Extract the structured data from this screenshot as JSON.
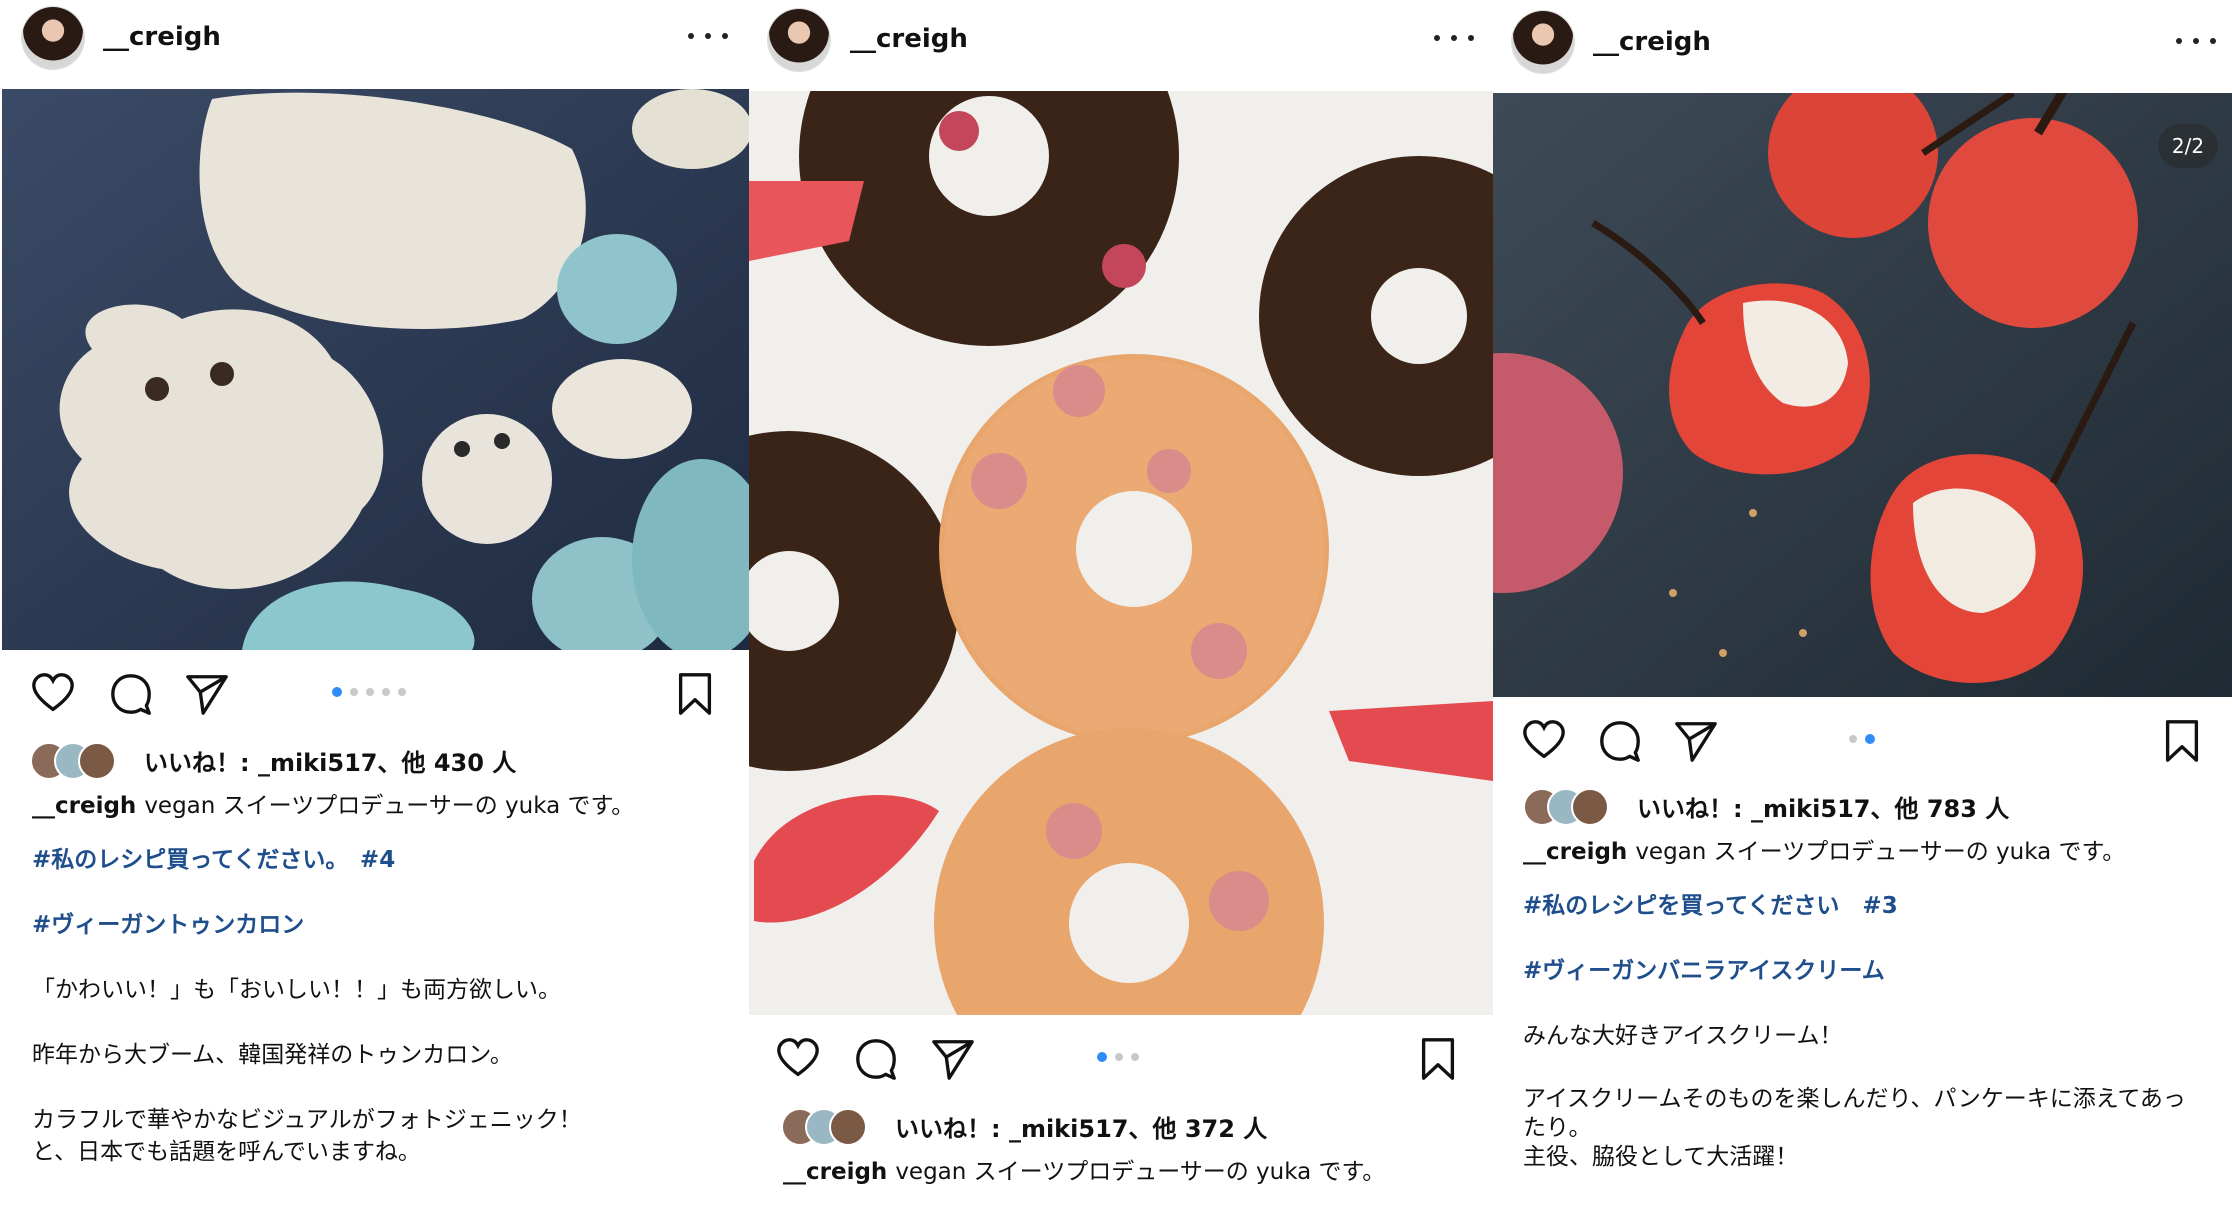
{
  "posts": [
    {
      "username": "__creigh",
      "likes_text": "いいね！: _miki517、他 430 人",
      "caption_user": "__creigh",
      "caption_intro": "vegan スイーツプロデューサーの yuka です。",
      "hashtag_line_1": "#私のレシピ買ってください。　#4",
      "hashtag_line_2": "#ヴィーガントゥンカロン",
      "body_1": "「かわいい！」も「おいしい！！」も両方欲しい。",
      "body_2": "昨年から大ブーム、韓国発祥のトゥンカロン。",
      "body_3": "カラフルで華やかなビジュアルがフォトジェニック！\nと、日本でも話題を呼んでいますね。",
      "carousel": {
        "count": 5,
        "active": 0
      }
    },
    {
      "username": "__creigh",
      "likes_text": "いいね！: _miki517、他 372 人",
      "caption_user": "__creigh",
      "caption_intro": "vegan スイーツプロデューサーの yuka です。",
      "carousel": {
        "count": 3,
        "active": 0
      }
    },
    {
      "username": "__creigh",
      "likes_text": "いいね！: _miki517、他 783 人",
      "caption_user": "__creigh",
      "caption_intro": "vegan スイーツプロデューサーの yuka です。",
      "hashtag_line_1": "#私のレシピを買ってください　#3",
      "hashtag_line_2": "#ヴィーガンバニラアイスクリーム",
      "body_1": "みんな大好きアイスクリーム！",
      "body_2": "アイスクリームそのものを楽しんだり、パンケーキに添えてあっ\nたり。\n主役、脇役として大活躍！",
      "media_counter": "2/2",
      "carousel": {
        "count": 2,
        "active": 1
      }
    }
  ],
  "icons": {
    "more": "more-horizontal-icon",
    "like": "heart-icon",
    "comment": "comment-icon",
    "share": "paper-plane-icon",
    "save": "bookmark-icon"
  },
  "colors": {
    "hashtag": "#1f4e8c",
    "carousel_active": "#2f8df5",
    "carousel_inactive": "#c9c9c9"
  }
}
